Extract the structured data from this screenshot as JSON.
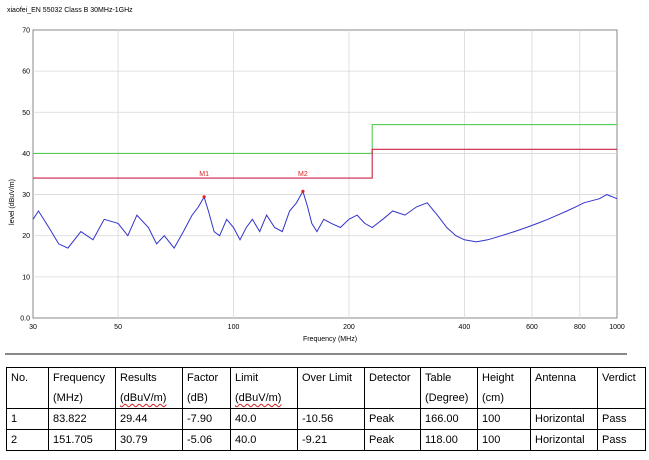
{
  "chart_data": {
    "type": "line",
    "title": "xiaofei_EN 55032 Class B 30MHz-1GHz",
    "xlabel": "Frequency (MHz)",
    "ylabel": "level (dBuV/m)",
    "xscale": "log",
    "xlim": [
      30,
      1000
    ],
    "ylim": [
      0,
      70
    ],
    "x_ticks": [
      30,
      50,
      100,
      200,
      400,
      600,
      800,
      1000
    ],
    "x_tick_labels": [
      "30",
      "50",
      "100",
      "200",
      "400",
      "600",
      "800",
      "1000"
    ],
    "y_ticks": [
      0,
      10,
      20,
      30,
      40,
      50,
      60,
      70
    ],
    "y_tick_labels": [
      "0.0",
      "10",
      "20",
      "30",
      "40",
      "50",
      "60",
      "70"
    ],
    "grid": true,
    "colors": {
      "trace": "#3333cc",
      "limit": "#cc2244",
      "limit_upper": "#55cc55",
      "marker": "#dd2222"
    },
    "series": [
      {
        "name": "",
        "kind": "limit-upper",
        "x": [
          30,
          230,
          230,
          1000
        ],
        "values": [
          40,
          40,
          47,
          47
        ]
      },
      {
        "name": "",
        "kind": "limit",
        "x": [
          30,
          230,
          230,
          1000
        ],
        "values": [
          34,
          34,
          41,
          41
        ]
      },
      {
        "name": "",
        "kind": "measurement",
        "x": [
          30,
          31,
          33,
          35,
          37,
          40,
          43,
          46,
          50,
          53,
          56,
          60,
          63,
          66,
          70,
          74,
          78,
          81,
          83.8,
          86,
          89,
          92,
          96,
          100,
          104,
          108,
          112,
          117,
          122,
          128,
          134,
          140,
          146,
          151.7,
          156,
          160,
          165,
          172,
          180,
          190,
          200,
          210,
          220,
          230,
          245,
          260,
          280,
          300,
          320,
          340,
          360,
          380,
          400,
          430,
          460,
          500,
          540,
          580,
          620,
          660,
          700,
          740,
          780,
          820,
          860,
          900,
          940,
          970,
          1000
        ],
        "values": [
          24,
          26,
          22,
          18,
          17,
          21,
          19,
          24,
          23,
          20,
          25,
          22,
          18,
          20,
          17,
          21,
          25,
          27,
          29.4,
          26,
          21,
          20,
          24,
          22,
          19,
          22,
          24,
          21,
          25,
          22,
          21,
          26,
          28,
          30.8,
          27,
          23,
          21,
          24,
          23,
          22,
          24,
          25,
          23,
          22,
          24,
          26,
          25,
          27,
          28,
          25,
          22,
          20,
          19,
          18.5,
          19,
          20,
          21,
          22,
          23,
          24,
          25,
          26,
          27,
          28,
          28.5,
          29,
          30,
          29.5,
          29
        ]
      }
    ],
    "markers": [
      {
        "label": "M1",
        "x": 83.822,
        "y": 29.44
      },
      {
        "label": "M2",
        "x": 151.705,
        "y": 30.79
      }
    ]
  },
  "table": {
    "headers_line1": [
      "No.",
      "Frequency",
      "Results",
      "Factor",
      "Limit",
      "Over Limit",
      "Detector",
      "Table",
      "Height",
      "Antenna",
      "Verdict"
    ],
    "headers_line2": [
      "",
      "(MHz)",
      "(dBuV/m)",
      "(dB)",
      "(dBuV/m)",
      "",
      "",
      "(Degree)",
      "(cm)",
      "",
      ""
    ],
    "rows": [
      [
        "1",
        "83.822",
        "29.44",
        "-7.90",
        "40.0",
        "-10.56",
        "Peak",
        "166.00",
        "100",
        "Horizontal",
        "Pass"
      ],
      [
        "2",
        "151.705",
        "30.79",
        "-5.06",
        "40.0",
        "-9.21",
        "Peak",
        "118.00",
        "100",
        "Horizontal",
        "Pass"
      ]
    ]
  }
}
